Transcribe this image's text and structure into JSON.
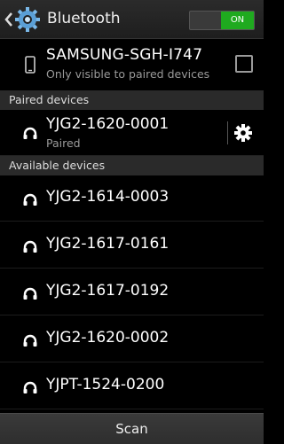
{
  "header": {
    "title": "Bluetooth",
    "toggle_label": "ON",
    "toggle_color": "#1faa1f"
  },
  "this_device": {
    "name": "SAMSUNG-SGH-I747",
    "subtitle": "Only visible to paired devices",
    "visible_checked": false
  },
  "sections": {
    "paired": "Paired devices",
    "available": "Available devices"
  },
  "paired_devices": [
    {
      "name": "YJG2-1620-0001",
      "status": "Paired"
    }
  ],
  "available_devices": [
    {
      "name": "YJG2-1614-0003"
    },
    {
      "name": "YJG2-1617-0161"
    },
    {
      "name": "YJG2-1617-0192"
    },
    {
      "name": "YJG2-1620-0002"
    },
    {
      "name": "YJPT-1524-0200"
    }
  ],
  "footer": {
    "scan_label": "Scan"
  }
}
